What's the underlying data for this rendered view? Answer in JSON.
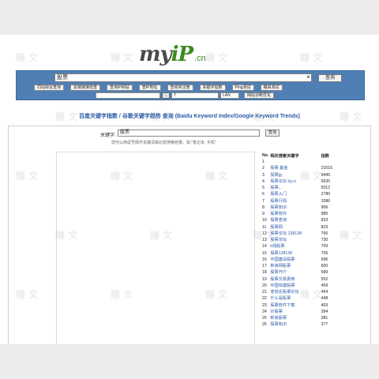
{
  "logo": {
    "my": "my",
    "ip": "iP",
    "cn": ".cn"
  },
  "search": {
    "value": "股票",
    "clear": "×",
    "button": "查询"
  },
  "tools": [
    "同站综合查询",
    "友链链接检查",
    "查询IP网站",
    "查IP地址",
    "查询买注册",
    "关键字指数",
    "Ping测试",
    "路由测试"
  ],
  "ip_row": {
    "button": "↓",
    "input": "T",
    "lan": "LAN",
    "diag": "网站诊断优化"
  },
  "title": "百度关键字指数 / 谷歌关键字趋势 查询 (Baidu Keyword Index/Google Keyword Trends)",
  "keyword": {
    "label": "关键字:",
    "value": "股票",
    "button": "查询",
    "hint": "您可以用逗号隔开关键词来比较搜索结果。如:\"笔记本, 手机\""
  },
  "table": {
    "headers": [
      "No.",
      "相关搜索关键字",
      "指数"
    ],
    "rows": [
      [
        "1",
        "",
        ""
      ],
      [
        "2",
        "股票 基金",
        "21016"
      ],
      [
        "3",
        "股票jg",
        "9445"
      ],
      [
        "4",
        "股票论坛 lq.cc",
        "5635"
      ],
      [
        "5",
        "股票...",
        "5012"
      ],
      [
        "6",
        "股票入门",
        "2780"
      ],
      [
        "7",
        "股票行情",
        "1086"
      ],
      [
        "8",
        "股票知识",
        "906"
      ],
      [
        "9",
        "股票软件",
        "985"
      ],
      [
        "10",
        "股票查询",
        "823"
      ],
      [
        "11",
        "股票网",
        "823"
      ],
      [
        "12",
        "股票论坛 138138",
        "766"
      ],
      [
        "13",
        "股票论坛",
        "730"
      ],
      [
        "14",
        "k线股票",
        "709"
      ],
      [
        "15",
        "股票138138",
        "706"
      ],
      [
        "16",
        "中国建设股票",
        "696"
      ],
      [
        "17",
        "新浪网股票",
        "600"
      ],
      [
        "18",
        "股票开户",
        "589"
      ],
      [
        "19",
        "股票交易费用",
        "552"
      ],
      [
        "20",
        "中国铁建股票",
        "459"
      ],
      [
        "21",
        "老钱庄股票论坛",
        "454"
      ],
      [
        "22",
        "什么是股票",
        "448"
      ],
      [
        "23",
        "股票软件下载",
        "403"
      ],
      [
        "24",
        "炒股票",
        "394"
      ],
      [
        "25",
        "新浪股票",
        "381"
      ],
      [
        "26",
        "股票知识",
        "377"
      ]
    ]
  },
  "watermark_text": "赚 文"
}
